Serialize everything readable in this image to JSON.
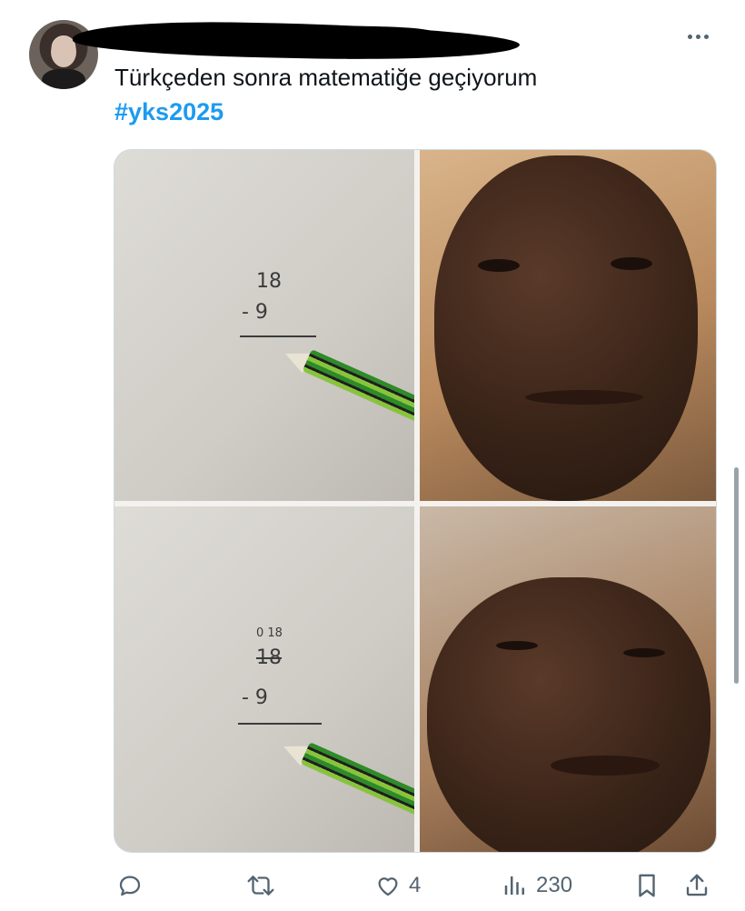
{
  "tweet": {
    "text": "Türkçeden sonra matematiğe geçiyorum",
    "hashtag": "#yks2025"
  },
  "media": {
    "top_math": {
      "line1": "18",
      "line2": "- 9"
    },
    "bottom_math": {
      "carry": "0 18",
      "line1": "18",
      "line2": "- 9"
    }
  },
  "actions": {
    "reply_count": "",
    "retweet_count": "",
    "like_count": "4",
    "view_count": "230"
  },
  "colors": {
    "accent": "#1d9bf0",
    "icon": "#536471",
    "text": "#0f1419"
  }
}
